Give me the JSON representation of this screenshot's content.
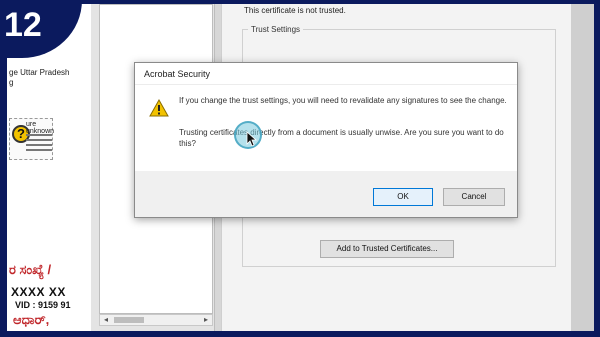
{
  "badge": {
    "number": "12"
  },
  "pdf_strip": {
    "location_line1": "ge Uttar Pradesh",
    "location_line2": "g",
    "stamp_text": "ure unknown",
    "kannada_top": "ರ ಸಂಖ್ಯೆ / ",
    "masked_number": "XXXX XX",
    "vid": "VID : 9159 91",
    "kannada_bottom": "ಆಧಾರ್,"
  },
  "certificate_window": {
    "status_text": "This certificate is not trusted.",
    "group_label": "Trust Settings",
    "add_button_label": "Add to Trusted Certificates..."
  },
  "dialog": {
    "title": "Acrobat Security",
    "message_1": "If you change the trust settings, you will need to revalidate any signatures to see the change.",
    "message_2": "Trusting certificates directly from a document is usually unwise. Are you sure you want to do this?",
    "ok_label": "OK",
    "cancel_label": "Cancel",
    "icon": "warning-icon"
  },
  "colors": {
    "frame": "#0b1a5e",
    "ok_border": "#0078d7",
    "warning": "#f2c200"
  }
}
